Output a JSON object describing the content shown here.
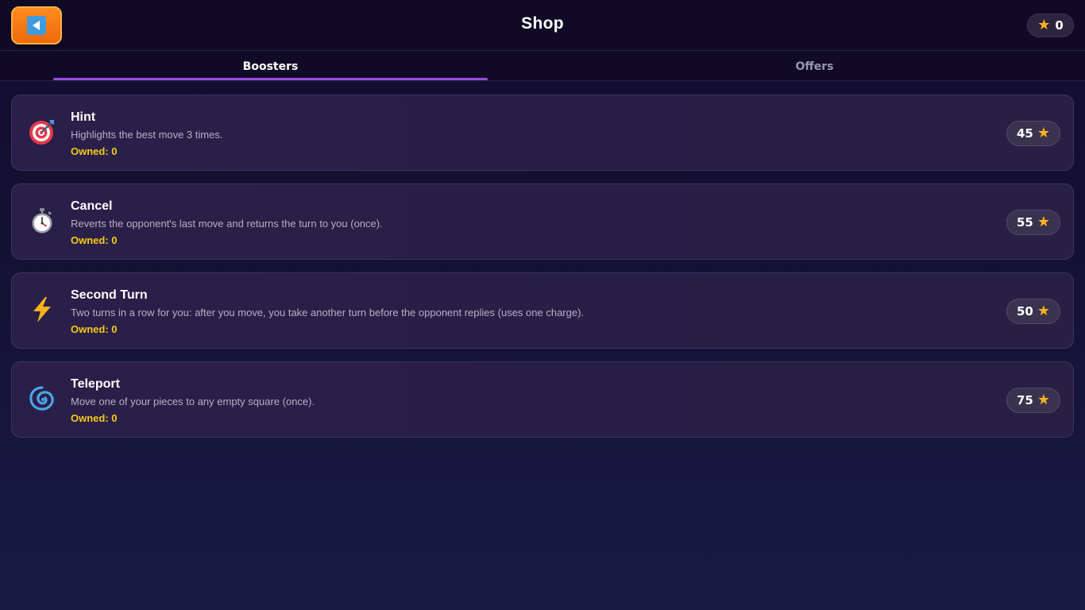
{
  "header": {
    "title": "Shop",
    "stars_balance": "0",
    "back_icon": "back-arrow-icon"
  },
  "tabs": [
    {
      "label": "Boosters",
      "active": true
    },
    {
      "label": "Offers",
      "active": false
    }
  ],
  "colors": {
    "accent": "#9b4de0",
    "owned": "#f5cc14",
    "star": "#ffb21e",
    "back_button": "#ef6a0a"
  },
  "boosters": [
    {
      "name": "Hint",
      "description": "Highlights the best move 3 times.",
      "owned": "Owned: 0",
      "price": "45",
      "icon": "target-icon"
    },
    {
      "name": "Cancel",
      "description": "Reverts the opponent's last move and returns the turn to you (once).",
      "owned": "Owned: 0",
      "price": "55",
      "icon": "stopwatch-icon"
    },
    {
      "name": "Second Turn",
      "description": "Two turns in a row for you: after you move, you take another turn before the opponent replies (uses one charge).",
      "owned": "Owned: 0",
      "price": "50",
      "icon": "lightning-icon"
    },
    {
      "name": "Teleport",
      "description": "Move one of your pieces to any empty square (once).",
      "owned": "Owned: 0",
      "price": "75",
      "icon": "swirl-icon"
    }
  ]
}
